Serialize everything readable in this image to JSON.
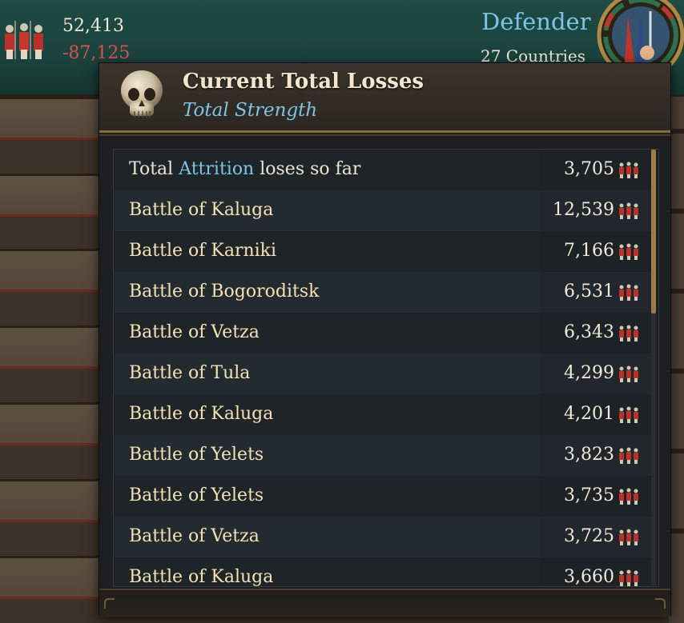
{
  "topbar": {
    "total_strength": "52,413",
    "losses_delta": "-87,125",
    "side_label": "Defender",
    "side_sub": "27 Countries"
  },
  "tooltip": {
    "title": "Current Total Losses",
    "subtitle": "Total Strength",
    "attrition_row": {
      "prefix": "Total ",
      "highlight": "Attrition",
      "suffix": " loses so far",
      "value": "3,705"
    },
    "battles": [
      {
        "label": "Battle of Kaluga",
        "value": "12,539"
      },
      {
        "label": "Battle of Karniki",
        "value": "7,166"
      },
      {
        "label": "Battle of Bogoroditsk",
        "value": "6,531"
      },
      {
        "label": "Battle of Vetza",
        "value": "6,343"
      },
      {
        "label": "Battle of Tula",
        "value": "4,299"
      },
      {
        "label": "Battle of Kaluga",
        "value": "4,201"
      },
      {
        "label": "Battle of Yelets",
        "value": "3,823"
      },
      {
        "label": "Battle of Yelets",
        "value": "3,735"
      },
      {
        "label": "Battle of Vetza",
        "value": "3,725"
      },
      {
        "label": "Battle of Kaluga",
        "value": "3,660"
      }
    ]
  },
  "icons": {
    "header": "skull-icon",
    "row": "soldiers-icon",
    "topbar": "soldiers-icon",
    "emblem": "war-emblem-icon"
  },
  "colors": {
    "accent_blue": "#7ec4e6",
    "loss_red": "#d8534a",
    "label_cream": "#f3e2b4",
    "gold_border": "#8a6a3c"
  }
}
